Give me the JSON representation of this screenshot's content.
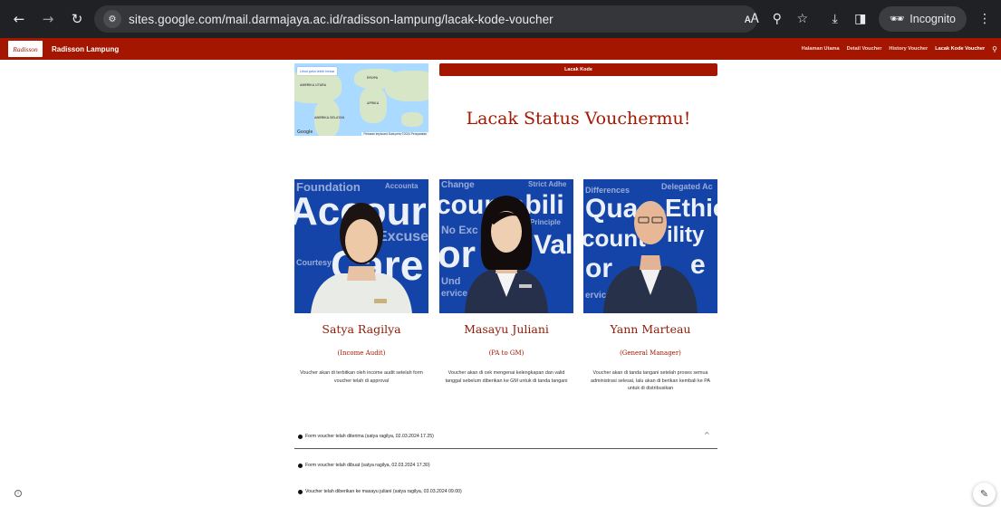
{
  "browser": {
    "url": "sites.google.com/mail.darmajaya.ac.id/radisson-lampung/lacak-kode-voucher",
    "incognito_label": "Incognito"
  },
  "site": {
    "logo_text": "Radisson",
    "brand": "Radisson Lampung",
    "menu": [
      "Halaman Utama",
      "Detail Voucher",
      "History Voucher",
      "Lacak Kode Voucher"
    ],
    "active_menu": "Lacak Kode Voucher",
    "accent_color": "#a51600"
  },
  "map": {
    "button": "Lihat peta lebih besar",
    "attribution": "Pintasan keyboard   Data peta ©2024   Persyaratan",
    "labels": [
      "AMERIKA UTARA",
      "EROPA",
      "AFRIKA",
      "AMERIKA SELATAN"
    ],
    "brand": "Google"
  },
  "lacak_button": "Lacak Kode",
  "heading": "Lacak Status Vouchermu!",
  "profiles": [
    {
      "name": "Satya Ragilya",
      "role": "(Income Audit)",
      "description": "Voucher akan di terbitkan oleh income audit setelah form voucher telah di approval",
      "bg_words": [
        "Foundation",
        "Accounta",
        "Accour",
        "Excuse",
        "Courtesy",
        "Care"
      ]
    },
    {
      "name": "Masayu Juliani",
      "role": "(PA to GM)",
      "description": "Voucher akan di cek mengenai kelengkapan dan valid tanggal sebelum diberikan ke GM untuk di tanda tangani",
      "bg_words": [
        "Change",
        "Strict Adhe",
        "countabili",
        "No Exc",
        "Principle",
        "or",
        "Val",
        "Und",
        "ervice"
      ]
    },
    {
      "name": "Yann Marteau",
      "role": "(General Manager)",
      "description": "Voucher akan di tanda tangani setelah proses semua administrasi selesai, lalu akan di berikan kembali ke PA untuk di distribusikan",
      "bg_words": [
        "Differences",
        "Delegated Ac",
        "Qua",
        "Ethic",
        "count",
        "ility",
        "or",
        "e",
        "ervic"
      ]
    }
  ],
  "timeline": [
    "Form voucher telah diterima (satya ragilya, 02.03.2024 17.25)",
    "Form voucher telah dibuat (satya ragilya, 02.03.2024 17.30)",
    "Voucher telah diberikan ke masayu juliani (satya ragilya, 03.03.2024 09.00)"
  ]
}
